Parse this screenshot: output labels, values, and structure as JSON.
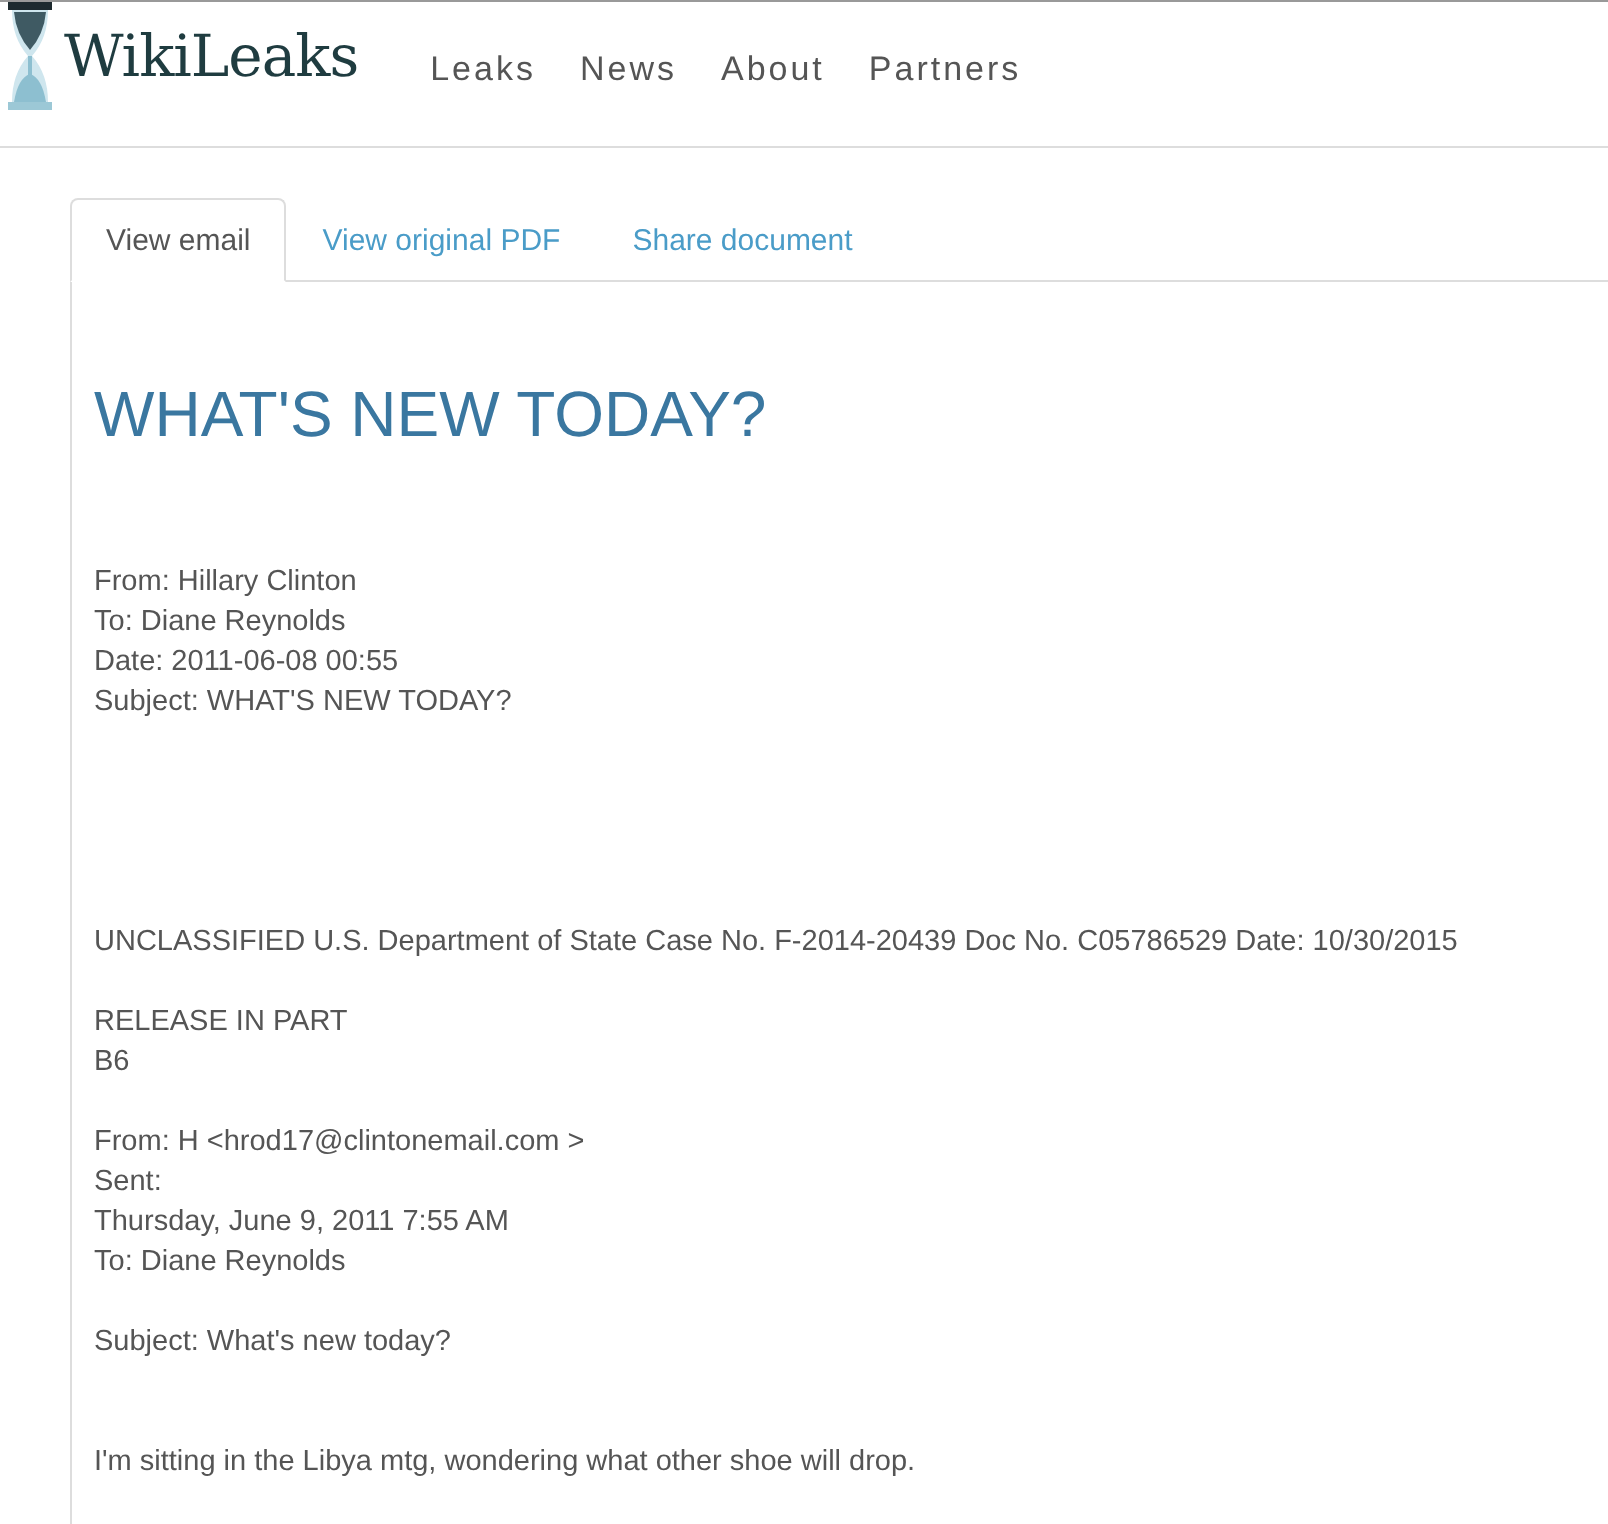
{
  "site": {
    "name": "WikiLeaks"
  },
  "nav": [
    "Leaks",
    "News",
    "About",
    "Partners"
  ],
  "tabs": [
    {
      "label": "View email",
      "selected": true
    },
    {
      "label": "View original PDF",
      "selected": false
    },
    {
      "label": "Share document",
      "selected": false
    }
  ],
  "email": {
    "title": "WHAT'S NEW TODAY?",
    "meta": [
      "From: Hillary Clinton",
      "To: Diane Reynolds",
      "Date: 2011-06-08 00:55",
      "Subject: WHAT'S NEW TODAY?"
    ],
    "body": [
      [
        "UNCLASSIFIED U.S. Department of State Case No. F-2014-20439 Doc No. C05786529 Date: 10/30/2015"
      ],
      [
        "RELEASE IN PART",
        "B6"
      ],
      [
        "From: H <hrod17@clintonemail.com >",
        "Sent:",
        "Thursday, June 9, 2011 7:55 AM",
        "To: Diane Reynolds"
      ],
      [
        "Subject: What's new today?"
      ],
      [
        "I'm sitting in the Libya mtg, wondering what other shoe will drop."
      ]
    ]
  }
}
